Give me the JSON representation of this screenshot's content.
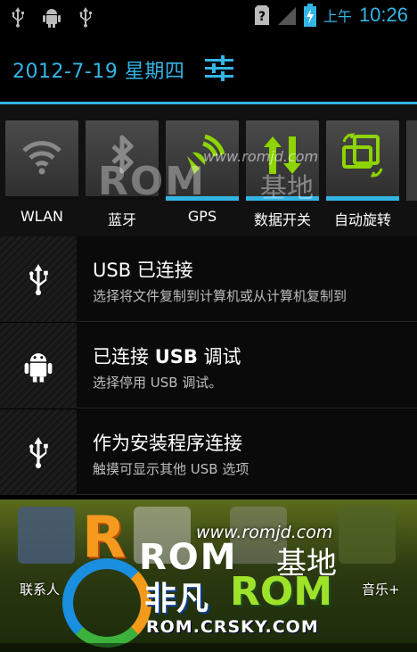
{
  "status_bar": {
    "left_icons": [
      "usb-icon",
      "android-debug-icon",
      "usb-icon"
    ],
    "right_icons": [
      "sim-unknown-icon",
      "signal-icon",
      "battery-charging-icon"
    ],
    "ampm": "上午",
    "time": "10:26"
  },
  "header": {
    "date": "2012-7-19 星期四",
    "settings_icon": "settings-sliders-icon"
  },
  "toggles": [
    {
      "label": "WLAN",
      "icon": "wifi-icon",
      "on": false
    },
    {
      "label": "蓝牙",
      "icon": "bluetooth-icon",
      "on": false
    },
    {
      "label": "GPS",
      "icon": "gps-icon",
      "on": true
    },
    {
      "label": "数据开关",
      "icon": "data-toggle-icon",
      "on": true
    },
    {
      "label": "自动旋转",
      "icon": "auto-rotate-icon",
      "on": true
    }
  ],
  "watermark": {
    "url": "www.romjd.com",
    "rom": "ROM",
    "jidi": "基地"
  },
  "notifications": [
    {
      "title": "USB 已连接",
      "text": "选择将文件复制到计算机或从计算机复制到",
      "icon": "usb-icon"
    },
    {
      "title_prefix": "已连接 ",
      "title_bold": "USB",
      "title_suffix": " 调试",
      "text": "选择停用 USB 调试。",
      "icon": "android-debug-icon"
    },
    {
      "title": "作为安装程序连接",
      "text": "触摸可显示其他 USB 选项",
      "icon": "usb-icon"
    }
  ],
  "home": {
    "left_label": "联系人",
    "right_label": "音乐+",
    "url": "www.romjd.com",
    "rom_text": "ROM",
    "jidi_text": "基地",
    "feifan": "非凡",
    "feifan_rom": "ROM",
    "crsky": "ROM.CRSKY.COM"
  },
  "colors": {
    "accent": "#33b5e5",
    "toggle_on": "#33b5e5",
    "icon_green": "#8dd400"
  }
}
